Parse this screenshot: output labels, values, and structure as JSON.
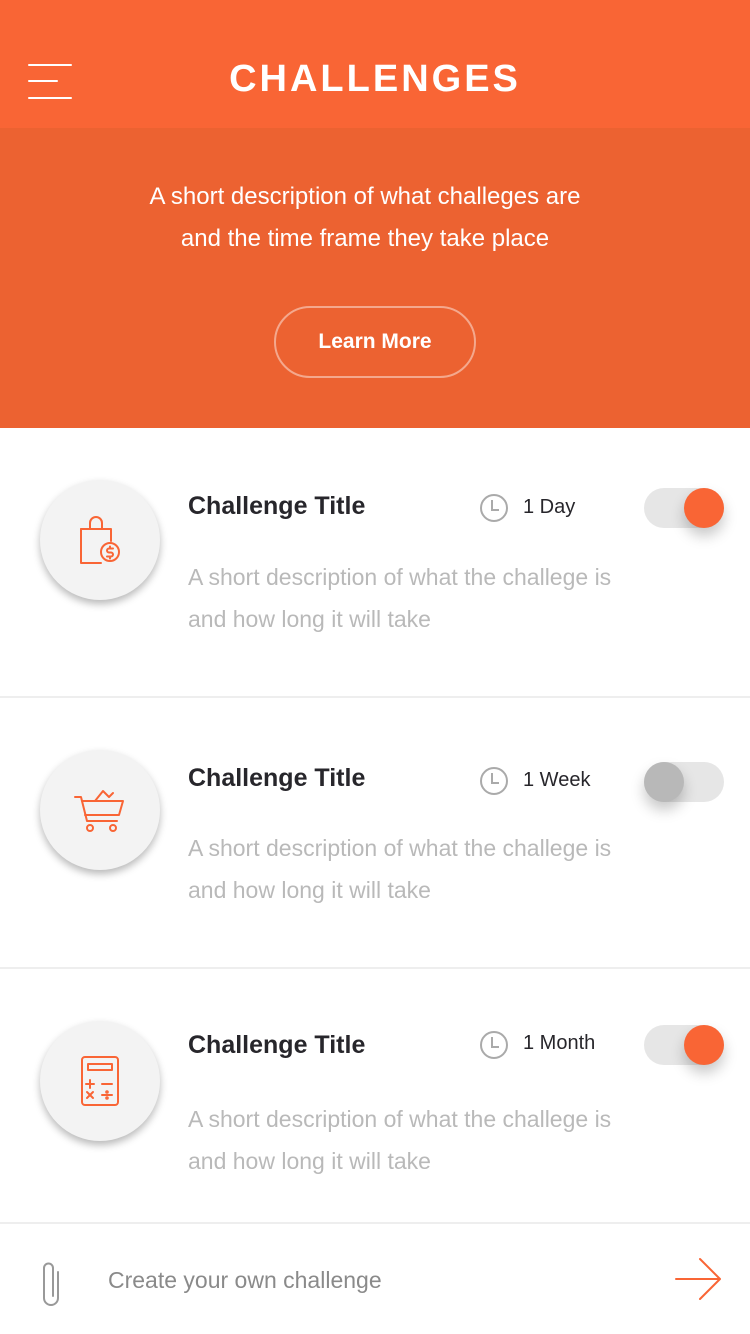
{
  "header": {
    "title": "CHALLENGES",
    "menu_icon": "hamburger-menu-icon"
  },
  "hero": {
    "description_line1": "A short description of what challeges are",
    "description_line2": "and the time frame they take place",
    "button_label": "Learn More"
  },
  "challenges": [
    {
      "icon": "shopping-bag-dollar-icon",
      "title": "Challenge Title",
      "duration": "1 Day",
      "enabled": true,
      "description_line1": "A short description of what the challege is",
      "description_line2": "and how long it will take"
    },
    {
      "icon": "shopping-cart-icon",
      "title": "Challenge Title",
      "duration": "1 Week",
      "enabled": false,
      "description_line1": "A short description of what the challege is",
      "description_line2": "and how long it will take"
    },
    {
      "icon": "calculator-icon",
      "title": "Challenge Title",
      "duration": "1 Month",
      "enabled": true,
      "description_line1": "A short description of what the challege is",
      "description_line2": "and how long it will take"
    }
  ],
  "footer": {
    "placeholder": "Create your own challenge",
    "attach_icon": "paperclip-icon",
    "submit_icon": "arrow-right-icon"
  },
  "colors": {
    "accent": "#f96535",
    "hero_bg": "#ec6231",
    "title_text": "#27262b",
    "muted_text": "#b9b9b9",
    "toggle_off_knob": "#b8b8b8",
    "toggle_track": "#e6e6e6"
  }
}
